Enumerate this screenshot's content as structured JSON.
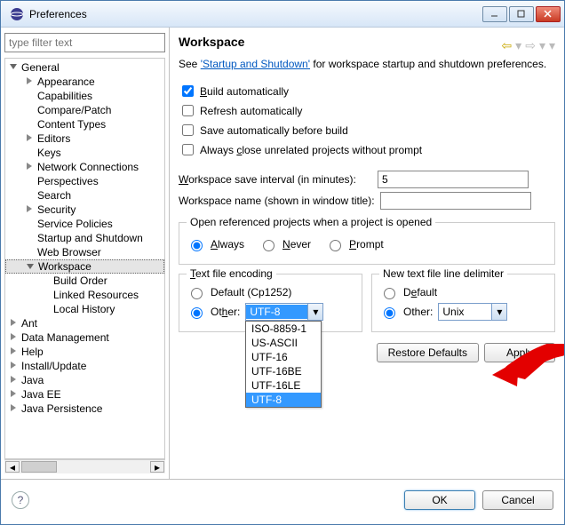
{
  "window": {
    "title": "Preferences"
  },
  "filter_placeholder": "type filter text",
  "tree": {
    "general": "General",
    "children": [
      "Appearance",
      "Capabilities",
      "Compare/Patch",
      "Content Types",
      "Editors",
      "Keys",
      "Network Connections",
      "Perspectives",
      "Search",
      "Security",
      "Service Policies",
      "Startup and Shutdown",
      "Web Browser",
      "Workspace"
    ],
    "workspace_children": [
      "Build Order",
      "Linked Resources",
      "Local History"
    ],
    "after": [
      "Ant",
      "Data Management",
      "Help",
      "Install/Update",
      "Java",
      "Java EE",
      "Java Persistence"
    ]
  },
  "page": {
    "title": "Workspace",
    "see_prefix": "See ",
    "see_link": "'Startup and Shutdown'",
    "see_suffix": " for workspace startup and shutdown preferences.",
    "build_auto": "Build automatically",
    "refresh_auto": "Refresh automatically",
    "save_before_build": "Save automatically before build",
    "close_unrelated": "Always close unrelated projects without prompt",
    "interval_label": "Workspace save interval (in minutes):",
    "interval_value": "5",
    "wsname_label": "Workspace name (shown in window title):",
    "wsname_value": "",
    "open_ref_legend": "Open referenced projects when a project is opened",
    "always": "Always",
    "never": "Never",
    "prompt": "Prompt",
    "encoding_legend": "Text file encoding",
    "default_enc": "Default (Cp1252)",
    "other": "Other:",
    "enc_value": "UTF-8",
    "enc_options": [
      "ISO-8859-1",
      "US-ASCII",
      "UTF-16",
      "UTF-16BE",
      "UTF-16LE",
      "UTF-8"
    ],
    "delim_legend": "New text file line delimiter",
    "default_delim": "Default",
    "delim_value": "Unix",
    "restore": "Restore Defaults",
    "apply": "Apply"
  },
  "footer": {
    "ok": "OK",
    "cancel": "Cancel"
  }
}
